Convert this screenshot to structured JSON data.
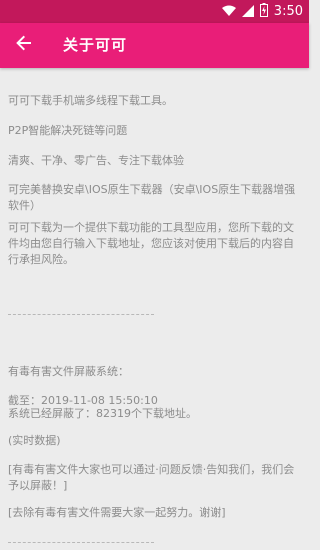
{
  "status_bar": {
    "time": "3:50",
    "icons": [
      "wifi-icon",
      "signal-icon",
      "battery-icon"
    ]
  },
  "app_bar": {
    "title": "关于可可",
    "back_icon": "arrow-left-icon"
  },
  "content": {
    "line1": "可可下载手机端多线程下载工具。",
    "line2": "P2P智能解决死链等问题",
    "line3": "清爽、干净、零广告、专注下载体验",
    "line4": "可完美替换安卓\\IOS原生下载器（安卓\\IOS原生下载器增强软件）",
    "line5": "可可下载为一个提供下载功能的工具型应用，您所下载的文件均由您自行输入下载地址，您应该对使用下载后的内容自行承担风险。",
    "divider1": "------------------------------------------",
    "block_title": "有毒有害文件屏蔽系统：",
    "cutoff": "截至：2019-11-08 15:50:10",
    "blocked": "系统已经屏蔽了：82319个下载地址。",
    "realtime": "(实时数据)",
    "report": "[有毒有害文件大家也可以通过·问题反馈·告知我们，我们会予以屏蔽！]",
    "thanks": "[去除有毒有害文件需要大家一起努力。谢谢]",
    "divider2": "------------------------------------------"
  },
  "colors": {
    "status_bar": "#c2185b",
    "app_bar": "#e91e78",
    "background": "#ececec",
    "text": "#8c8c8c"
  }
}
